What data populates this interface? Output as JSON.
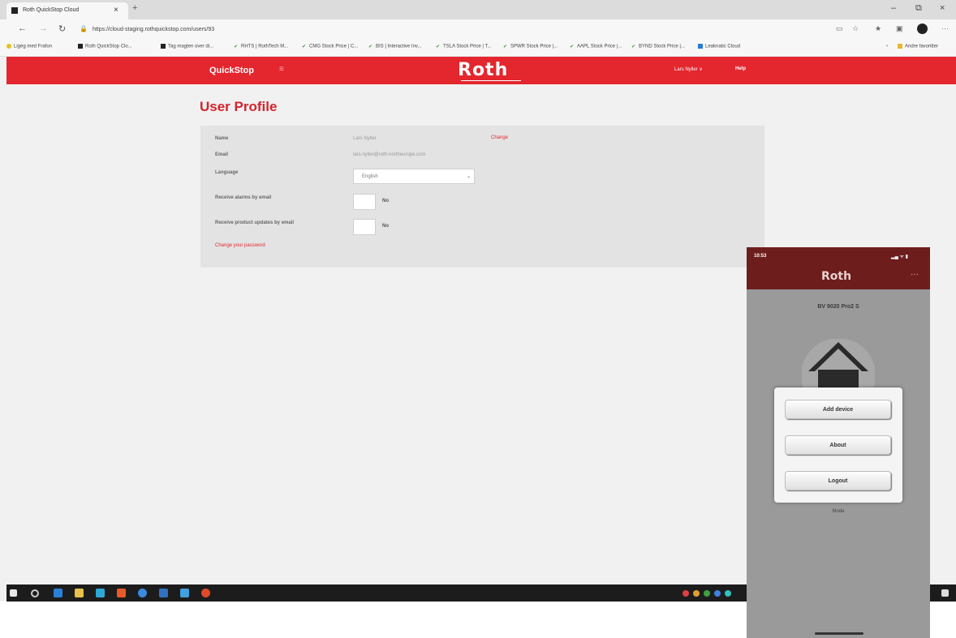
{
  "browser": {
    "tab_title": "Roth QuickStop Cloud",
    "url": "https://cloud-staging.rothquickstop.com/users/93",
    "bookmarks": [
      "Ligeg med Frafon",
      "Roth QuickStop Clo...",
      "Tag magten over di...",
      "RHTS | RothTech M...",
      "CMG Stock Price | C...",
      "BIS | Interactive Inv...",
      "TSLA Stock Price | T...",
      "SPWR Stock Price |...",
      "AAPL Stock Price |...",
      "BYND Stock Price |...",
      "Leaknatic Cloud"
    ],
    "other_bookmarks": "Andre favoritter"
  },
  "header": {
    "brand": "QuickStop",
    "logo": "Roth",
    "user": "Lars Nyller ∨",
    "help": "Help"
  },
  "profile": {
    "title": "User Profile",
    "name_label": "Name",
    "name_value": "Lars Nyller",
    "change_link": "Change",
    "email_label": "Email",
    "email_value": "lars.nyller@roth-northeurope.com",
    "language_label": "Language",
    "language_value": "English",
    "alarms_label": "Receive alarms by email",
    "alarms_value": "No",
    "updates_label": "Receive product updates by email",
    "updates_value": "No",
    "password_link": "Change your password"
  },
  "phone": {
    "time": "10:53",
    "logo": "Roth",
    "device_name": "BV 9020 Pro2 S",
    "menu": [
      "Add device",
      "About",
      "Logout"
    ],
    "mode_label": "Mode"
  }
}
